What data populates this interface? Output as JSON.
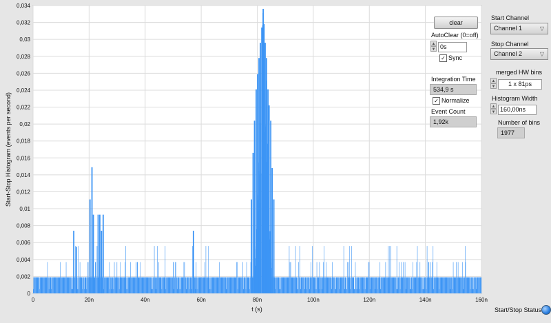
{
  "chart_data": {
    "type": "bar",
    "xlabel": "t (s)",
    "ylabel": "Start-Stop Histogram (events per second)",
    "xlim": [
      0,
      160
    ],
    "ylim": [
      0,
      0.034
    ],
    "x_ticks": [
      "0",
      "20n",
      "40n",
      "60n",
      "80n",
      "100n",
      "120n",
      "140n",
      "160n"
    ],
    "y_ticks": [
      "0",
      "0,002",
      "0,004",
      "0,006",
      "0,008",
      "0,01",
      "0,012",
      "0,014",
      "0,016",
      "0,018",
      "0,02",
      "0,022",
      "0,024",
      "0,026",
      "0,028",
      "0,03",
      "0,032",
      "0,034"
    ],
    "color": "#3d95f5",
    "grid": true,
    "baseline_level": 0.0019,
    "baseline_low": 0.0005,
    "sparse_levels": [
      0.0037,
      0.0056
    ],
    "peaks": [
      {
        "x": 14.5,
        "y": 0.0074
      },
      {
        "x": 15.4,
        "y": 0.0055
      },
      {
        "x": 20.3,
        "y": 0.0111
      },
      {
        "x": 21.0,
        "y": 0.0149
      },
      {
        "x": 21.5,
        "y": 0.0093
      },
      {
        "x": 23.2,
        "y": 0.0093
      },
      {
        "x": 23.8,
        "y": 0.0093
      },
      {
        "x": 24.4,
        "y": 0.0074
      },
      {
        "x": 25.0,
        "y": 0.0093
      },
      {
        "x": 57.2,
        "y": 0.0074
      },
      {
        "x": 77.9,
        "y": 0.0111
      },
      {
        "x": 78.5,
        "y": 0.0166
      },
      {
        "x": 79.0,
        "y": 0.0204
      },
      {
        "x": 79.6,
        "y": 0.0241
      },
      {
        "x": 80.1,
        "y": 0.0259
      },
      {
        "x": 80.6,
        "y": 0.0278
      },
      {
        "x": 81.1,
        "y": 0.0296
      },
      {
        "x": 81.6,
        "y": 0.0314
      },
      {
        "x": 82.1,
        "y": 0.0336
      },
      {
        "x": 82.4,
        "y": 0.0318
      },
      {
        "x": 82.8,
        "y": 0.0296
      },
      {
        "x": 83.3,
        "y": 0.0278
      },
      {
        "x": 83.8,
        "y": 0.0241
      },
      {
        "x": 84.2,
        "y": 0.0222
      },
      {
        "x": 84.8,
        "y": 0.0204
      },
      {
        "x": 85.3,
        "y": 0.0148
      },
      {
        "x": 85.9,
        "y": 0.0111
      }
    ],
    "gaps": [
      {
        "x0": 79.2,
        "x1": 85.0,
        "y": 0.0019
      }
    ]
  },
  "controls": {
    "clear": "clear",
    "autoclear_label": "AutoClear (0=off)",
    "autoclear_value": "0s",
    "sync_label": "Sync",
    "sync_checked": "✓",
    "integration_label": "Integration Time",
    "integration_value": "534,9 s",
    "normalize_label": "Normalize",
    "normalize_checked": "✓",
    "event_count_label": "Event Count",
    "event_count_value": "1,92k",
    "start_channel_label": "Start Channel",
    "start_channel_value": "Channel 1",
    "stop_channel_label": "Stop Channel",
    "stop_channel_value": "Channel 2",
    "merged_bins_label": "merged HW bins",
    "merged_bins_value": "1 x 81ps",
    "hist_width_label": "Histogram Width",
    "hist_width_value": "160,00ns",
    "num_bins_label": "Number of bins",
    "num_bins_value": "1977",
    "status_label": "Start/Stop Status"
  }
}
